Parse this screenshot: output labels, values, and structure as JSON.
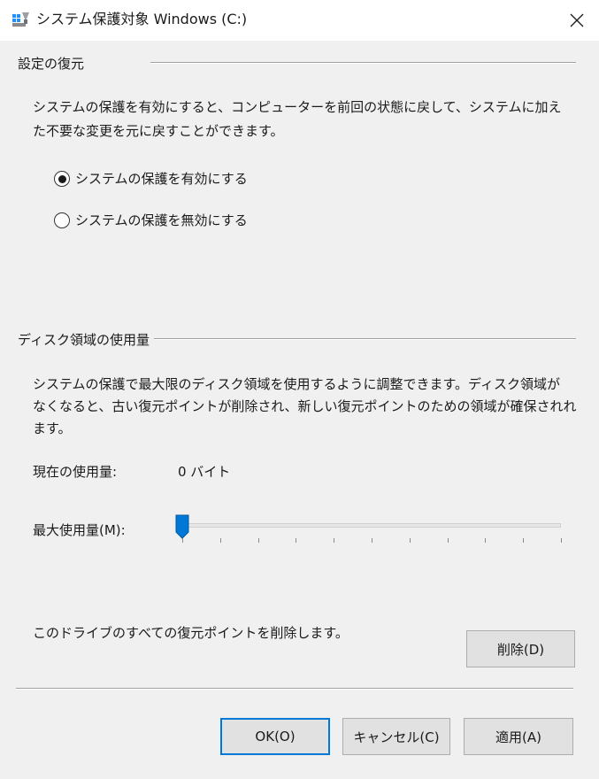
{
  "titlebar": {
    "title": "システム保護対象 Windows (C:)"
  },
  "restore": {
    "group_label": "設定の復元",
    "description_line1": "システムの保護を有効にすると、コンピューターを前回の状態に戻して、システムに加え",
    "description_line2": "た不要な変更を元に戻すことができます。",
    "options": [
      {
        "label": "システムの保護を有効にする",
        "selected": true
      },
      {
        "label": "システムの保護を無効にする",
        "selected": false
      }
    ]
  },
  "disk": {
    "group_label": "ディスク領域の使用量",
    "description_line1": "システムの保護で最大限のディスク領域を使用するように調整できます。ディスク領域が",
    "description_line2": "なくなると、古い復元ポイントが削除され、新しい復元ポイントのための領域が確保されれ",
    "description_line3": "ます。",
    "current_usage_label": "現在の使用量:",
    "current_usage_value": "0 バイト",
    "max_usage_label": "最大使用量(M):",
    "max_usage_fraction": 0.0
  },
  "delete_section": {
    "text": "このドライブのすべての復元ポイントを削除します。",
    "delete_button": "削除(D)"
  },
  "footer": {
    "ok_button": "OK(O)",
    "cancel_button": "キャンセル(C)",
    "apply_button": "適用(A)"
  },
  "colors": {
    "accent": "#0078d7",
    "window_bg": "#f0f0f0"
  }
}
